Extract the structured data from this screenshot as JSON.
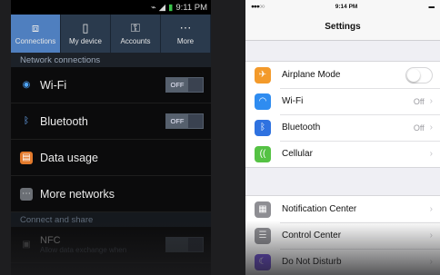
{
  "android": {
    "status": {
      "time": "9:11 PM"
    },
    "tabs": [
      {
        "label": "Connections",
        "icon": "connections-icon"
      },
      {
        "label": "My device",
        "icon": "device-icon"
      },
      {
        "label": "Accounts",
        "icon": "key-icon"
      },
      {
        "label": "More",
        "icon": "more-icon"
      }
    ],
    "section_network": "Network connections",
    "rows": [
      {
        "label": "Wi-Fi",
        "toggle": "OFF",
        "icon": "wifi-icon"
      },
      {
        "label": "Bluetooth",
        "toggle": "OFF",
        "icon": "bluetooth-icon"
      },
      {
        "label": "Data usage",
        "icon": "data-usage-icon"
      },
      {
        "label": "More networks",
        "icon": "more-networks-icon"
      }
    ],
    "section_connect": "Connect and share",
    "nfc": {
      "label": "NFC",
      "sub": "Allow data exchange when"
    }
  },
  "ios": {
    "status": {
      "carrier": "●●●○○",
      "time": "9:14 PM",
      "battery": "▬"
    },
    "title": "Settings",
    "group1": [
      {
        "label": "Airplane Mode",
        "icon": "airplane-icon",
        "color": "#f39a2b",
        "switch": true
      },
      {
        "label": "Wi-Fi",
        "value": "Off",
        "icon": "wifi-icon",
        "color": "#2f8cf0"
      },
      {
        "label": "Bluetooth",
        "value": "Off",
        "icon": "bluetooth-icon",
        "color": "#2f72e0"
      },
      {
        "label": "Cellular",
        "icon": "cellular-icon",
        "color": "#55c244"
      }
    ],
    "group2": [
      {
        "label": "Notification Center",
        "icon": "notification-center-icon",
        "color": "#8e8e93"
      },
      {
        "label": "Control Center",
        "icon": "control-center-icon",
        "color": "#8e8e93"
      },
      {
        "label": "Do Not Disturb",
        "icon": "moon-icon",
        "color": "#6a4ad0"
      }
    ]
  }
}
